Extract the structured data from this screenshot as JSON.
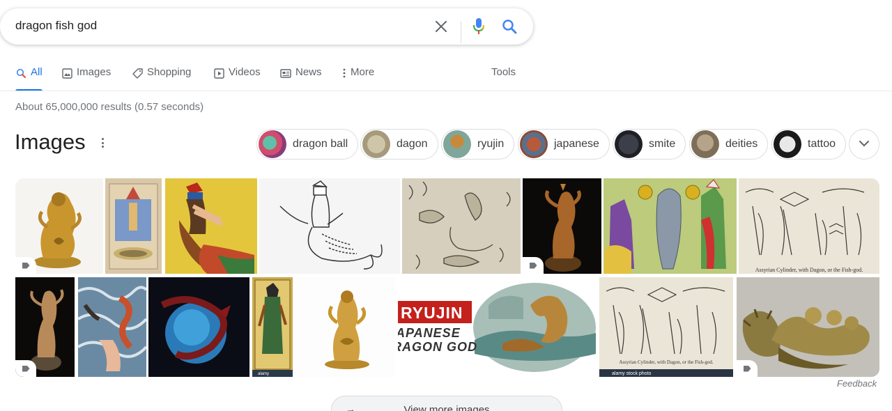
{
  "search": {
    "query": "dragon fish god"
  },
  "tabs": [
    {
      "label": "All",
      "icon": "search-icon",
      "active": true
    },
    {
      "label": "Images",
      "icon": "image-icon"
    },
    {
      "label": "Shopping",
      "icon": "tag-icon"
    },
    {
      "label": "Videos",
      "icon": "play-icon"
    },
    {
      "label": "News",
      "icon": "news-icon"
    },
    {
      "label": "More",
      "icon": "more-vertical-icon"
    }
  ],
  "tools_label": "Tools",
  "result_stats": "About 65,000,000 results (0.57 seconds)",
  "images_section": {
    "title": "Images",
    "chips": [
      {
        "label": "dragon ball"
      },
      {
        "label": "dagon"
      },
      {
        "label": "ryujin"
      },
      {
        "label": "japanese"
      },
      {
        "label": "smite"
      },
      {
        "label": "deities"
      },
      {
        "label": "tattoo"
      }
    ],
    "banner_line1": "RYUJIN",
    "banner_line2": "JAPANESE",
    "banner_line3": "DRAGON GOD",
    "caption_cylinder": "Assyrian Cylinder, with Dagon, or the Fish-god.",
    "caption_cylinder2": "Assyrian Cylinder, with Dagon, or the Fish-god.",
    "watermark_alamy": "alamy stock photo",
    "watermark_alamy_short": "alamy",
    "feedback_label": "Feedback",
    "view_more_label": "View more images"
  },
  "colors": {
    "accent": "#1a73e8",
    "text_secondary": "#70757a",
    "border": "#dadce0"
  }
}
